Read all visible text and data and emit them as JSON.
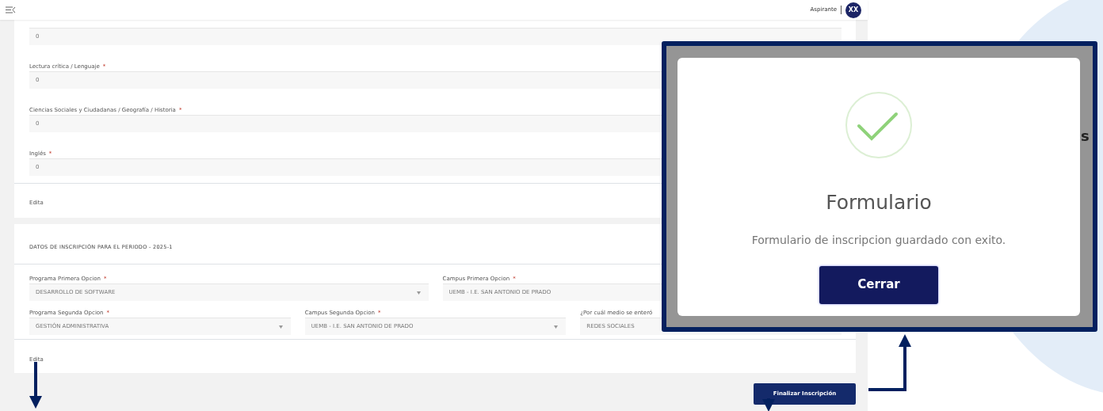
{
  "header": {
    "user_role": "Aspirante",
    "avatar_initials": "XX"
  },
  "scores_section": {
    "fields": [
      {
        "value": "0"
      },
      {
        "label": "Lectura crítica / Lenguaje",
        "required_mark": "*",
        "value": "0"
      },
      {
        "label": "Ciencias Sociales y Ciudadanas / Geografía / Historia",
        "required_mark": "*",
        "value": "0"
      },
      {
        "label": "Inglés",
        "required_mark": "*",
        "value": "0"
      }
    ],
    "edit_link": "Edita"
  },
  "registration_section": {
    "title": "DATOS DE INSCRIPCIÓN PARA EL PERIODO - 2025-1",
    "rows": [
      [
        {
          "label": "Programa Primera Opcion",
          "required_mark": "*",
          "value": "DESARROLLO DE SOFTWARE",
          "kind": "select"
        },
        {
          "label": "Campus Primera Opcion",
          "required_mark": "*",
          "value": "UEMB - I.E. SAN ANTONIO DE PRADO",
          "kind": "select"
        }
      ],
      [
        {
          "label": "Programa Segunda Opcion",
          "required_mark": "*",
          "value": "GESTIÓN ADMINISTRATIVA",
          "kind": "select"
        },
        {
          "label": "Campus Segunda Opcion",
          "required_mark": "*",
          "value": "UEMB - I.E. SAN ANTONIO DE PRADO",
          "kind": "select"
        },
        {
          "label": "¿Por cuál medio se enteró",
          "value": "REDES SOCIALES",
          "kind": "select"
        }
      ]
    ],
    "edit_link": "Edita"
  },
  "submit_button": "Finalizar Inscripción",
  "background_text": "s",
  "modal": {
    "title": "Formulario",
    "message": "Formulario de inscripcion guardado con exito.",
    "close_button": "Cerrar"
  }
}
